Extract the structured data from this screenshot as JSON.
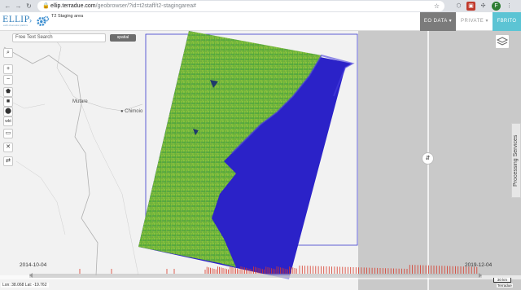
{
  "browser": {
    "url_host": "ellip.terradue.com",
    "url_path": "/geobrowser/?id=t2staff/t2-stagingarea#",
    "back_icon": "arrow-left-icon",
    "forward_icon": "arrow-right-icon",
    "reload_icon": "reload-icon"
  },
  "header": {
    "logo_text": "ELLIP",
    "logo_subtext": "earth observation platform",
    "breadcrumb": "T2 Staging area",
    "menu": {
      "eo_data": "EO DATA",
      "private": "PRIVATE",
      "user": "FBRITO"
    }
  },
  "search": {
    "placeholder": "Free Text Search",
    "spatial_label": "spatial"
  },
  "tools": [
    {
      "name": "search-icon",
      "glyph": "🔍"
    },
    {
      "name": "zoom-in-icon",
      "glyph": "+"
    },
    {
      "name": "zoom-out-icon",
      "glyph": "−"
    },
    {
      "name": "draw-polygon-icon",
      "glyph": "⬟"
    },
    {
      "name": "draw-rectangle-icon",
      "glyph": "■"
    },
    {
      "name": "draw-point-icon",
      "glyph": "●"
    },
    {
      "name": "wkt-icon",
      "glyph": "wkt"
    },
    {
      "name": "import-icon",
      "glyph": "▭"
    },
    {
      "name": "clear-icon",
      "glyph": "✕"
    },
    {
      "name": "swap-icon",
      "glyph": "⇄"
    }
  ],
  "map": {
    "places": [
      "Mutare",
      "Chimoio"
    ]
  },
  "side": {
    "processing_services": "Processing Services"
  },
  "timeline": {
    "start_date": "2014-10-04",
    "end_date": "2019-12-04",
    "coords": "Lon: 38.068 Lat: -19.762",
    "scale": "30 km",
    "attribution": "Terradue"
  },
  "colors": {
    "accent": "#5cc4d4",
    "active_menu": "#7b7b7b",
    "footprint": "#3a3acc",
    "timeline_ticks": "#d83a2a"
  }
}
